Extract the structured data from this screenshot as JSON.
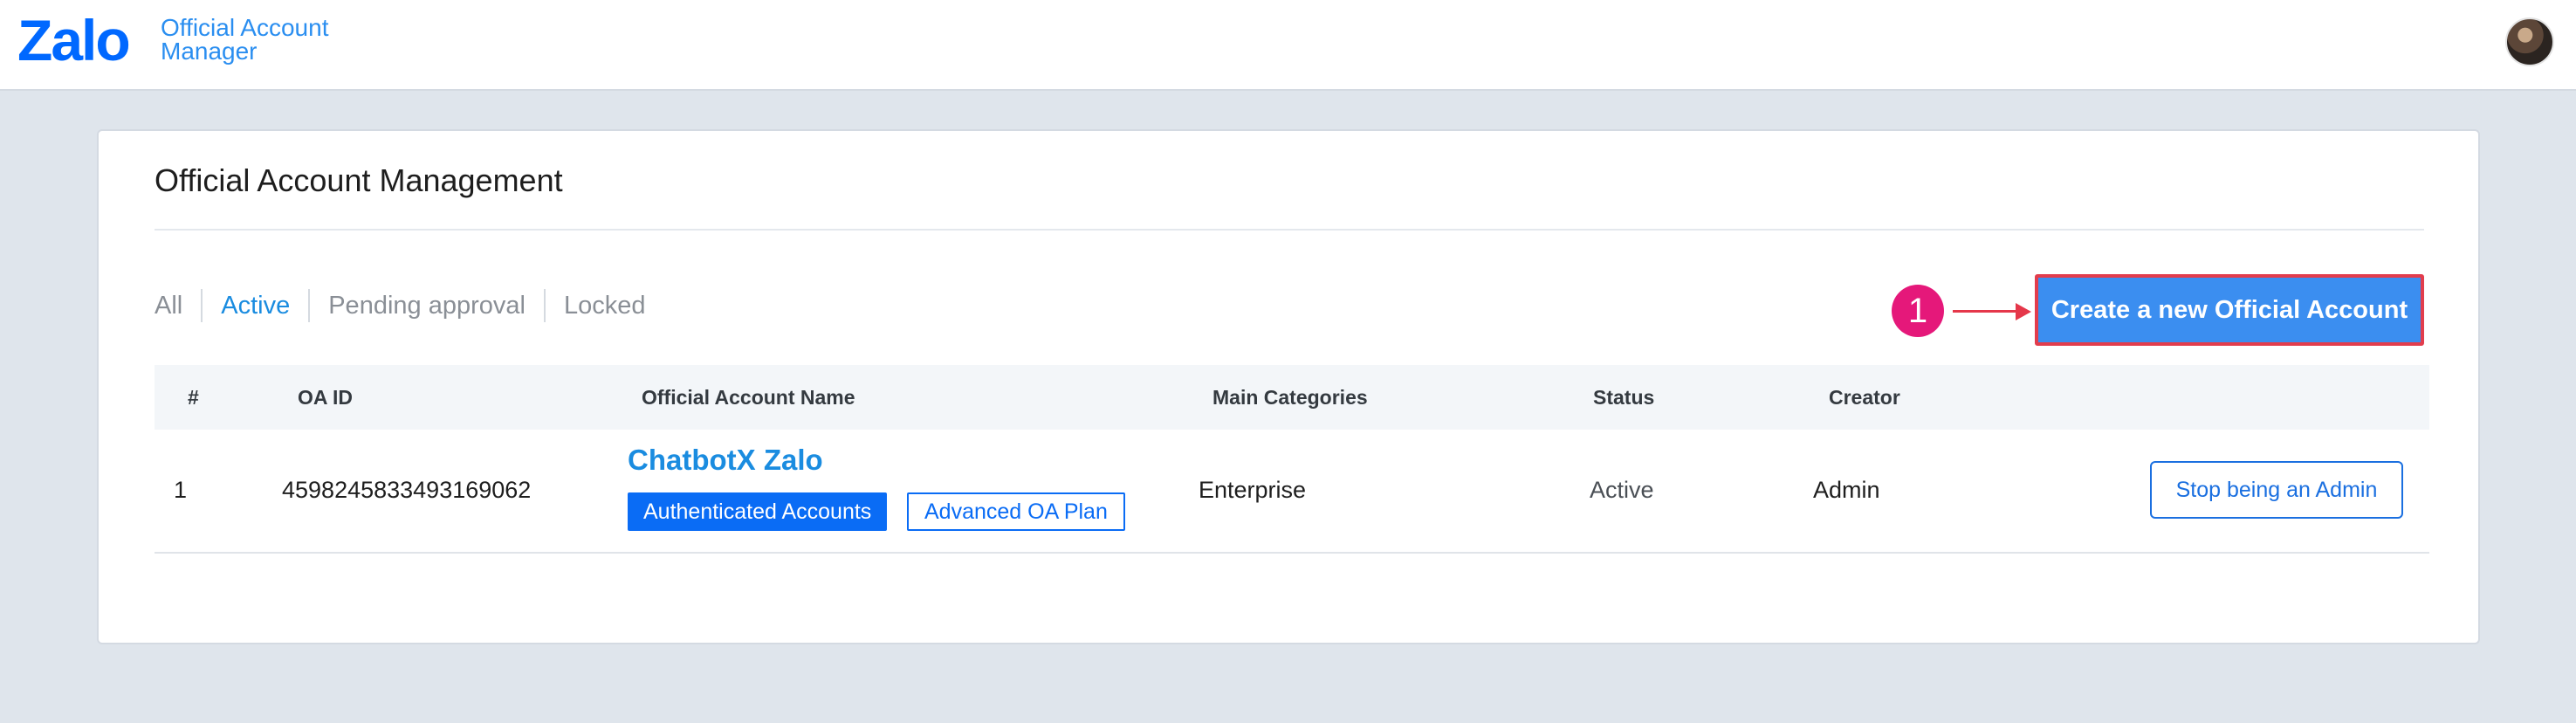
{
  "header": {
    "logo_wordmark": "Zalo",
    "logo_line1": "Official Account",
    "logo_line2": "Manager",
    "avatar_icon": "user-avatar"
  },
  "card": {
    "title": "Official Account Management",
    "filters": [
      "All",
      "Active",
      "Pending approval",
      "Locked"
    ],
    "active_filter": "Active",
    "annotation_step": "1",
    "create_button": "Create a new Official Account"
  },
  "table": {
    "columns": [
      "#",
      "OA ID",
      "Official Account Name",
      "Main Categories",
      "Status",
      "Creator"
    ],
    "rows": [
      {
        "index": "1",
        "oa_id": "4598245833493169062",
        "name": "ChatbotX Zalo",
        "badges": [
          "Authenticated Accounts",
          "Advanced OA Plan"
        ],
        "category": "Enterprise",
        "status": "Active",
        "creator": "Admin",
        "action": "Stop being an Admin"
      }
    ]
  },
  "colors": {
    "brand": "#0068ff",
    "link": "#1a8ce0",
    "primary_button": "#3b8ef0",
    "annotation": "#e5187a"
  }
}
